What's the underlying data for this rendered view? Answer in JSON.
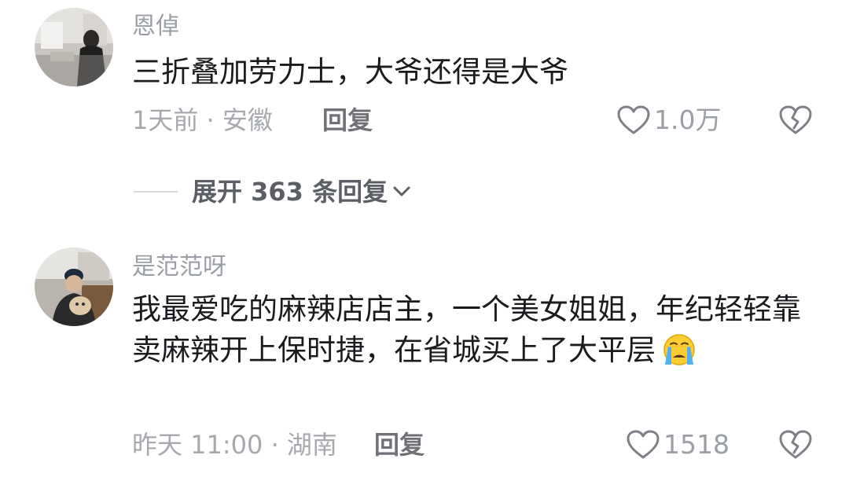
{
  "comments": [
    {
      "username": "恩倬",
      "text": "三折叠加劳力士，大爷还得是大爷",
      "time": "1天前",
      "location": "安徽",
      "reply_label": "回复",
      "like_count": "1.0万"
    },
    {
      "username": "是范范呀",
      "text": "我最爱吃的麻辣店店主，一个美女姐姐，年纪轻轻靠卖麻辣开上保时捷，在省城买上了大平层",
      "time": "昨天 11:00",
      "location": "湖南",
      "reply_label": "回复",
      "like_count": "1518"
    }
  ],
  "expand_replies": {
    "label": "展开 363 条回复"
  },
  "separator": "·",
  "icons": {
    "like": "heart-outline-icon",
    "dislike": "broken-heart-icon",
    "expand": "chevron-down-icon",
    "emoji": "crying-face-emoji"
  },
  "colors": {
    "text": "#1b1b1f",
    "secondary": "#9a9ea5",
    "reply": "#6f7177"
  }
}
